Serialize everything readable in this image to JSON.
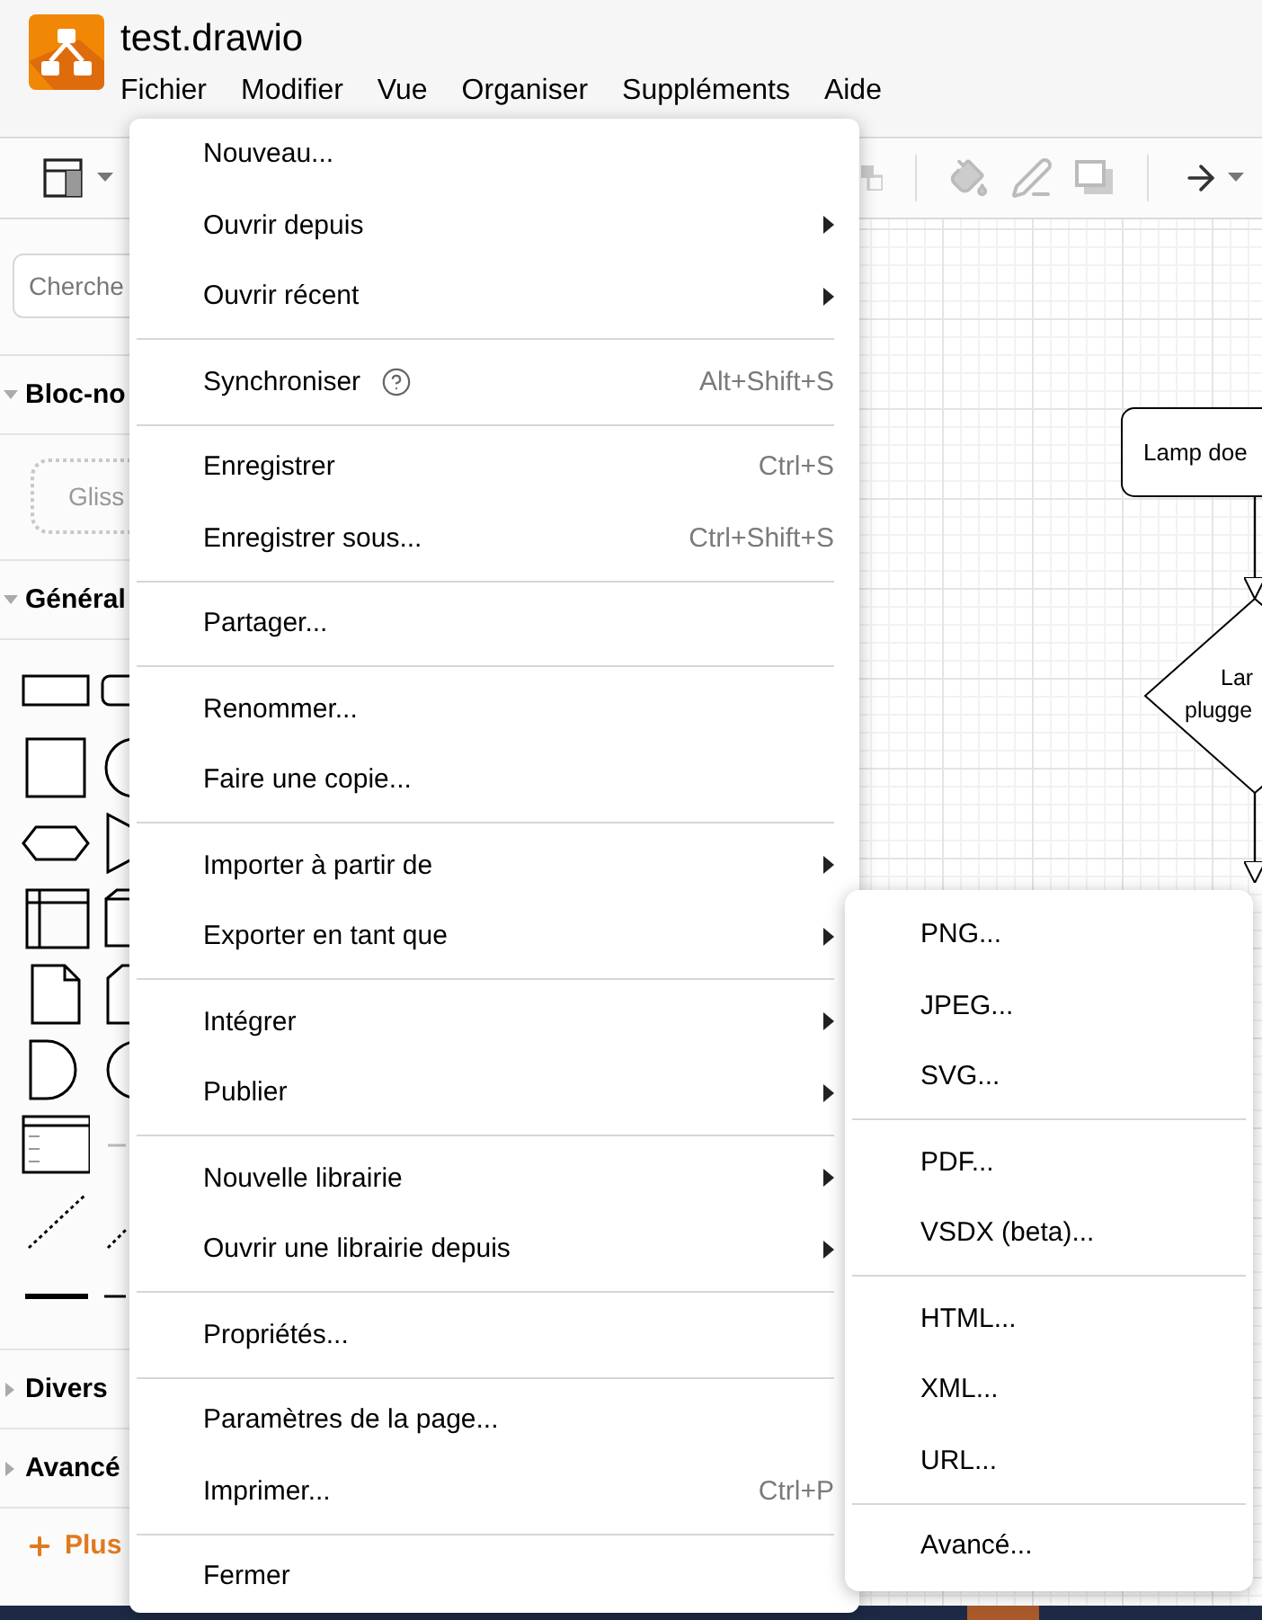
{
  "window": {
    "title": "test.drawio"
  },
  "menubar": [
    {
      "label": "Fichier"
    },
    {
      "label": "Modifier"
    },
    {
      "label": "Vue"
    },
    {
      "label": "Organiser"
    },
    {
      "label": "Suppléments"
    },
    {
      "label": "Aide"
    }
  ],
  "sidebar": {
    "search": {
      "placeholder": "Cherche"
    },
    "sections": [
      {
        "title": "Bloc-no",
        "expanded": true,
        "kind": "scratchpad",
        "hint": "Gliss"
      },
      {
        "title": "Général",
        "expanded": true,
        "kind": "shapes"
      },
      {
        "title": "Divers",
        "expanded": false
      },
      {
        "title": "Avancé",
        "expanded": false
      }
    ],
    "more_shapes": "Plus"
  },
  "diagram": {
    "nodes": [
      {
        "kind": "process",
        "label": [
          "Lamp doe"
        ]
      },
      {
        "kind": "decision",
        "label": [
          "Lar",
          "plugge"
        ]
      }
    ]
  },
  "file_menu": [
    {
      "kind": "item",
      "label": "Nouveau...",
      "submenu": false
    },
    {
      "kind": "item",
      "label": "Ouvrir depuis",
      "submenu": true
    },
    {
      "kind": "item",
      "label": "Ouvrir récent",
      "submenu": true
    },
    {
      "kind": "separator"
    },
    {
      "kind": "item",
      "label": "Synchroniser",
      "submenu": false,
      "help": true,
      "shortcut": "Alt+Shift+S"
    },
    {
      "kind": "separator"
    },
    {
      "kind": "item",
      "label": "Enregistrer",
      "submenu": false,
      "shortcut": "Ctrl+S"
    },
    {
      "kind": "item",
      "label": "Enregistrer sous...",
      "submenu": false,
      "shortcut": "Ctrl+Shift+S"
    },
    {
      "kind": "separator"
    },
    {
      "kind": "item",
      "label": "Partager...",
      "submenu": false
    },
    {
      "kind": "separator"
    },
    {
      "kind": "item",
      "label": "Renommer...",
      "submenu": false
    },
    {
      "kind": "item",
      "label": "Faire une copie...",
      "submenu": false
    },
    {
      "kind": "separator"
    },
    {
      "kind": "item",
      "label": "Importer à partir de",
      "submenu": true
    },
    {
      "kind": "item",
      "label": "Exporter en tant que",
      "submenu": true
    },
    {
      "kind": "separator"
    },
    {
      "kind": "item",
      "label": "Intégrer",
      "submenu": true
    },
    {
      "kind": "item",
      "label": "Publier",
      "submenu": true
    },
    {
      "kind": "separator"
    },
    {
      "kind": "item",
      "label": "Nouvelle librairie",
      "submenu": true
    },
    {
      "kind": "item",
      "label": "Ouvrir une librairie depuis",
      "submenu": true
    },
    {
      "kind": "separator"
    },
    {
      "kind": "item",
      "label": "Propriétés...",
      "submenu": false
    },
    {
      "kind": "separator"
    },
    {
      "kind": "item",
      "label": "Paramètres de la page...",
      "submenu": false
    },
    {
      "kind": "item",
      "label": "Imprimer...",
      "submenu": false,
      "shortcut": "Ctrl+P"
    },
    {
      "kind": "separator"
    },
    {
      "kind": "item",
      "label": "Fermer",
      "submenu": false
    }
  ],
  "export_submenu": [
    {
      "kind": "item",
      "label": "PNG..."
    },
    {
      "kind": "item",
      "label": "JPEG..."
    },
    {
      "kind": "item",
      "label": "SVG..."
    },
    {
      "kind": "separator"
    },
    {
      "kind": "item",
      "label": "PDF..."
    },
    {
      "kind": "item",
      "label": "VSDX (beta)..."
    },
    {
      "kind": "separator"
    },
    {
      "kind": "item",
      "label": "HTML..."
    },
    {
      "kind": "item",
      "label": "XML..."
    },
    {
      "kind": "item",
      "label": "URL..."
    },
    {
      "kind": "separator"
    },
    {
      "kind": "item",
      "label": "Avancé..."
    }
  ]
}
